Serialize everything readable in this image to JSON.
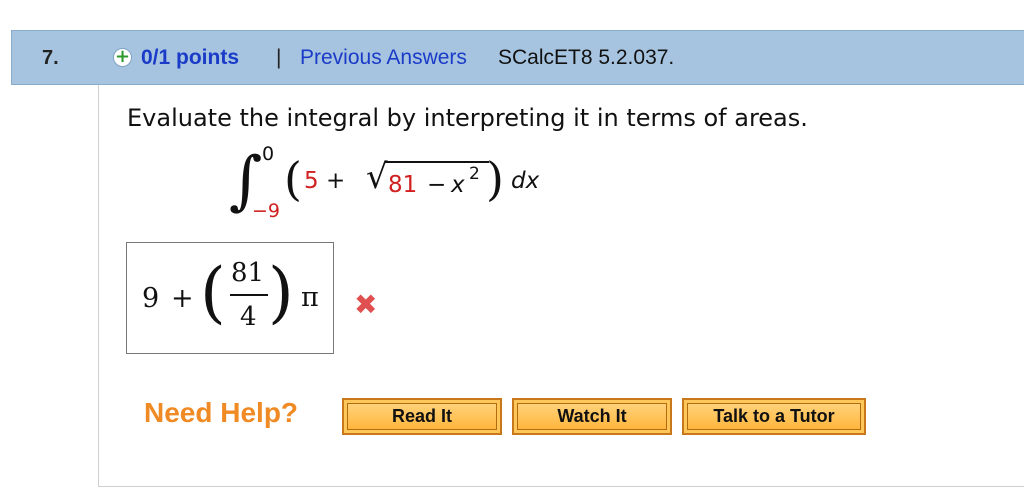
{
  "header": {
    "question_number": "7.",
    "expand_icon": "plus-circle-icon",
    "points": "0/1 points",
    "separator": "|",
    "previous_answers": "Previous Answers",
    "problem_code": "SCalcET8 5.2.037."
  },
  "question": {
    "prompt": "Evaluate the integral by interpreting it in terms of areas.",
    "integral": {
      "symbol": "∫",
      "upper_limit": "0",
      "lower_limit": "−9",
      "left_paren": "(",
      "constant": "5",
      "plus": "+",
      "sqrt_symbol": "√",
      "radicand_number": "81",
      "radicand_minus": "−",
      "radicand_var": "x",
      "radicand_exponent": "2",
      "right_paren": ")",
      "differential": "dx"
    }
  },
  "answer": {
    "whole": "9",
    "plus": "+",
    "left_paren": "(",
    "numerator": "81",
    "denominator": "4",
    "right_paren": ")",
    "pi": "π",
    "status_icon": "incorrect-x-icon",
    "status_color": "#e05050"
  },
  "help": {
    "label": "Need Help?",
    "buttons": [
      "Read It",
      "Watch It",
      "Talk to a Tutor"
    ]
  },
  "colors": {
    "header_bg": "#a6c4e0",
    "link_blue": "#1a3ac8",
    "highlight_red": "#d02020",
    "help_orange": "#f08a24",
    "button_orange": "#ffc65a"
  }
}
